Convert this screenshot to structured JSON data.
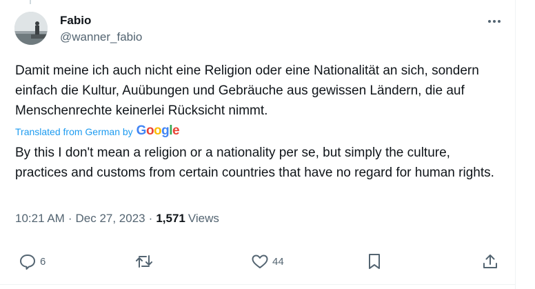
{
  "tweet": {
    "author": {
      "display_name": "Fabio",
      "handle": "@wanner_fabio"
    },
    "original_text": "Damit meine ich auch nicht eine Religion oder eine Nationalität an sich, sondern einfach die Kultur, Auübungen und Gebräuche aus gewissen Ländern, die auf Menschenrechte keinerlei Rücksicht nimmt.",
    "translation": {
      "label": "Translated from German by",
      "provider_letters": [
        {
          "char": "G",
          "color": "#4285F4"
        },
        {
          "char": "o",
          "color": "#EA4335"
        },
        {
          "char": "o",
          "color": "#FBBC05"
        },
        {
          "char": "g",
          "color": "#4285F4"
        },
        {
          "char": "l",
          "color": "#34A853"
        },
        {
          "char": "e",
          "color": "#EA4335"
        }
      ],
      "text": "By this I don't mean a religion or a nationality per se, but simply the culture, practices and customs from certain countries that have no regard for human rights."
    },
    "meta": {
      "time": "10:21 AM",
      "separator": "·",
      "date": "Dec 27, 2023",
      "views_count": "1,571",
      "views_label": "Views"
    },
    "actions": {
      "reply": {
        "icon": "reply-icon",
        "count": "6"
      },
      "retweet": {
        "icon": "retweet-icon",
        "count": ""
      },
      "like": {
        "icon": "heart-icon",
        "count": "44"
      },
      "bookmark": {
        "icon": "bookmark-icon"
      },
      "share": {
        "icon": "share-icon"
      }
    },
    "colors": {
      "text_primary": "#0f1419",
      "text_secondary": "#536471",
      "link": "#1d9bf0",
      "border": "#eff3f4"
    }
  }
}
